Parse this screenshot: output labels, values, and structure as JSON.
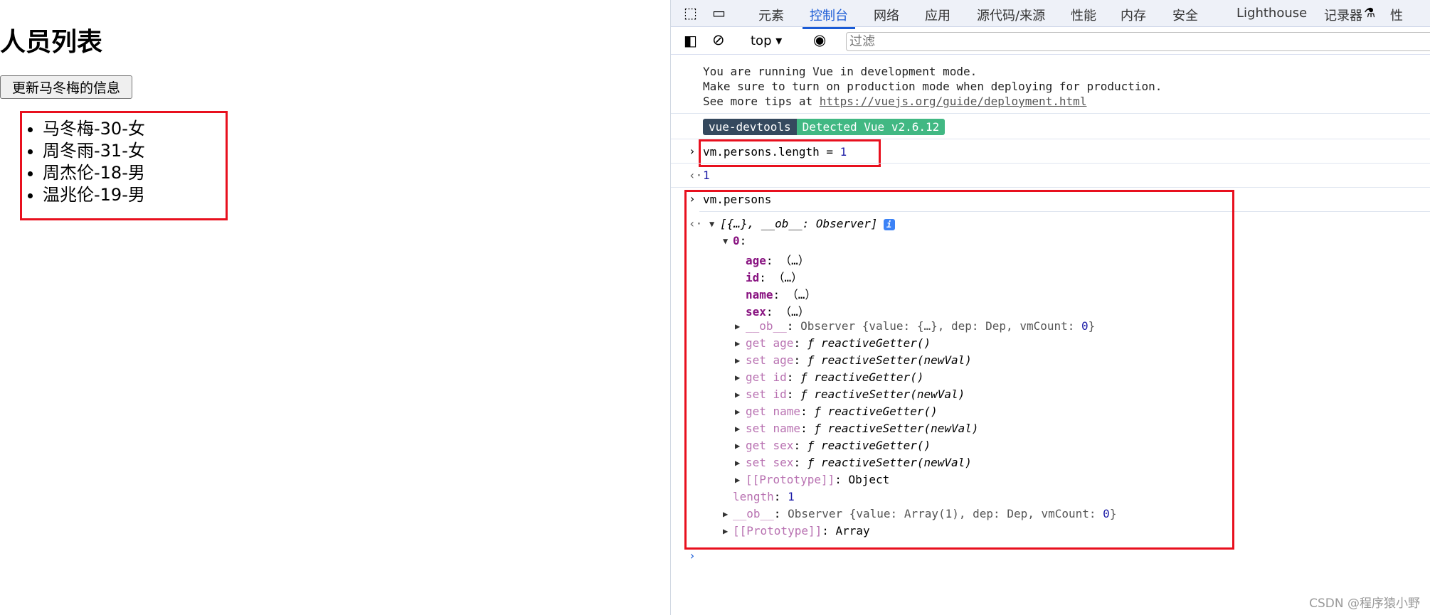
{
  "page": {
    "title": "人员列表",
    "button": "更新马冬梅的信息",
    "persons": [
      "马冬梅-30-女",
      "周冬雨-31-女",
      "周杰伦-18-男",
      "温兆伦-19-男"
    ]
  },
  "devtools": {
    "tabs": [
      "元素",
      "控制台",
      "网络",
      "应用",
      "源代码/来源",
      "性能",
      "内存",
      "安全",
      "Lighthouse",
      "记录器",
      "性"
    ],
    "active_tab": "控制台",
    "context": "top",
    "filter_placeholder": "过滤",
    "vue_msg": [
      "You are running Vue in development mode.",
      "Make sure to turn on production mode when deploying for production.",
      "See more tips at "
    ],
    "vue_link": "https://vuejs.org/guide/deployment.html",
    "badge_left": "vue-devtools",
    "badge_right": "Detected Vue v2.6.12",
    "cmd1": "vm.persons.length = ",
    "cmd1_val": "1",
    "result1": "1",
    "cmd2": "vm.persons",
    "tree": [
      {
        "i": 0,
        "t": "down",
        "s": [
          [
            "[{…}, __ob__: Observer]",
            "it"
          ]
        ],
        "info": true
      },
      {
        "i": 1,
        "t": "down",
        "s": [
          [
            "0",
            "key"
          ],
          [
            ":",
            ""
          ]
        ]
      },
      {
        "i": 2,
        "s": [
          [
            "age",
            "key"
          ],
          [
            ": （…）",
            ""
          ]
        ]
      },
      {
        "i": 2,
        "s": [
          [
            "id",
            "key"
          ],
          [
            ": （…）",
            ""
          ]
        ]
      },
      {
        "i": 2,
        "s": [
          [
            "name",
            "key"
          ],
          [
            ": （…）",
            ""
          ]
        ]
      },
      {
        "i": 2,
        "s": [
          [
            "sex",
            "key"
          ],
          [
            ": （…）",
            ""
          ]
        ]
      },
      {
        "i": 2,
        "t": "right",
        "s": [
          [
            "__ob__",
            "key2"
          ],
          [
            ": ",
            ""
          ],
          [
            "Observer {value: {…}, dep: Dep, vmCount: ",
            "gray"
          ],
          [
            "0",
            "num"
          ],
          [
            "}",
            "gray"
          ]
        ]
      },
      {
        "i": 2,
        "t": "right",
        "s": [
          [
            "get age",
            "key2"
          ],
          [
            ": ",
            ""
          ],
          [
            "ƒ reactiveGetter()",
            "it"
          ]
        ]
      },
      {
        "i": 2,
        "t": "right",
        "s": [
          [
            "set age",
            "key2"
          ],
          [
            ": ",
            ""
          ],
          [
            "ƒ reactiveSetter(newVal)",
            "it"
          ]
        ]
      },
      {
        "i": 2,
        "t": "right",
        "s": [
          [
            "get id",
            "key2"
          ],
          [
            ": ",
            ""
          ],
          [
            "ƒ reactiveGetter()",
            "it"
          ]
        ]
      },
      {
        "i": 2,
        "t": "right",
        "s": [
          [
            "set id",
            "key2"
          ],
          [
            ": ",
            ""
          ],
          [
            "ƒ reactiveSetter(newVal)",
            "it"
          ]
        ]
      },
      {
        "i": 2,
        "t": "right",
        "s": [
          [
            "get name",
            "key2"
          ],
          [
            ": ",
            ""
          ],
          [
            "ƒ reactiveGetter()",
            "it"
          ]
        ]
      },
      {
        "i": 2,
        "t": "right",
        "s": [
          [
            "set name",
            "key2"
          ],
          [
            ": ",
            ""
          ],
          [
            "ƒ reactiveSetter(newVal)",
            "it"
          ]
        ]
      },
      {
        "i": 2,
        "t": "right",
        "s": [
          [
            "get sex",
            "key2"
          ],
          [
            ": ",
            ""
          ],
          [
            "ƒ reactiveGetter()",
            "it"
          ]
        ]
      },
      {
        "i": 2,
        "t": "right",
        "s": [
          [
            "set sex",
            "key2"
          ],
          [
            ": ",
            ""
          ],
          [
            "ƒ reactiveSetter(newVal)",
            "it"
          ]
        ]
      },
      {
        "i": 2,
        "t": "right",
        "s": [
          [
            "[[Prototype]]",
            "key2"
          ],
          [
            ": Object",
            ""
          ]
        ]
      },
      {
        "i": 1,
        "s": [
          [
            "length",
            "key2"
          ],
          [
            ": ",
            ""
          ],
          [
            "1",
            "num"
          ]
        ]
      },
      {
        "i": 1,
        "t": "right",
        "s": [
          [
            "__ob__",
            "key2"
          ],
          [
            ": ",
            ""
          ],
          [
            "Observer {value: Array(1), dep: Dep, vmCount: ",
            "gray"
          ],
          [
            "0",
            "num"
          ],
          [
            "}",
            "gray"
          ]
        ]
      },
      {
        "i": 1,
        "t": "right",
        "s": [
          [
            "[[Prototype]]",
            "key2"
          ],
          [
            ": Array",
            ""
          ]
        ]
      }
    ],
    "watermark": "CSDN @程序猿小野"
  }
}
